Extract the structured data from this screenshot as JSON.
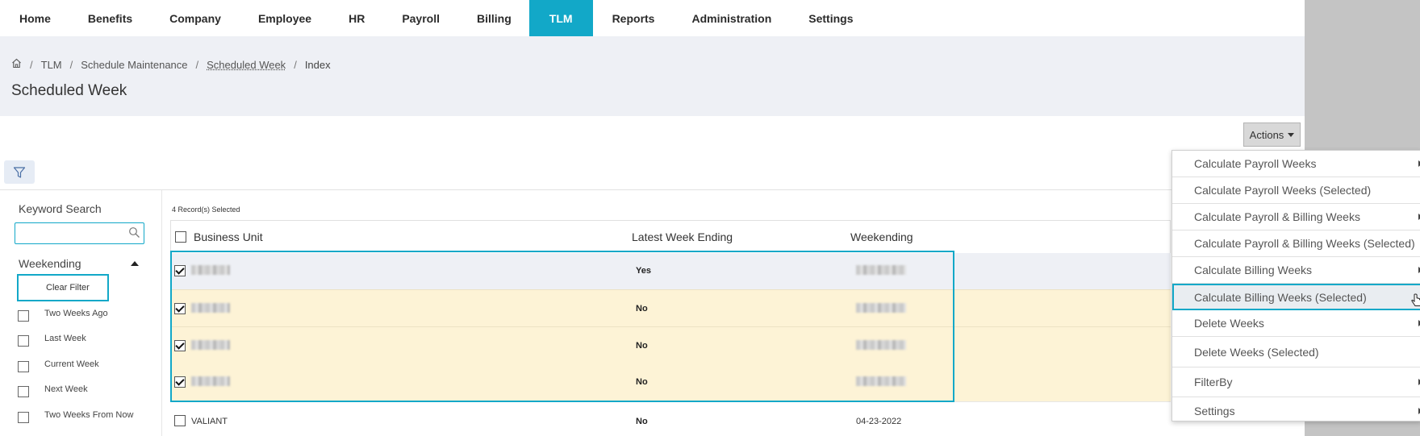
{
  "nav": {
    "items": [
      "Home",
      "Benefits",
      "Company",
      "Employee",
      "HR",
      "Payroll",
      "Billing",
      "TLM",
      "Reports",
      "Administration",
      "Settings"
    ],
    "active": "TLM"
  },
  "breadcrumb": {
    "items": [
      "TLM",
      "Schedule Maintenance",
      "Scheduled Week",
      "Index"
    ]
  },
  "page_title": "Scheduled Week",
  "actions_label": "Actions",
  "sidebar": {
    "keyword_label": "Keyword Search",
    "keyword_value": "",
    "weekending_label": "Weekending",
    "clear_filter": "Clear Filter",
    "options": [
      "Two Weeks Ago",
      "Last Week",
      "Current Week",
      "Next Week",
      "Two Weeks From Now"
    ]
  },
  "table": {
    "records_selected": "4 Record(s) Selected",
    "headers": {
      "business_unit": "Business Unit",
      "latest": "Latest Week Ending",
      "weekending": "Weekending"
    },
    "rows": [
      {
        "business_unit": "",
        "latest": "Yes",
        "weekending": "",
        "checked": true
      },
      {
        "business_unit": "",
        "latest": "No",
        "weekending": "",
        "checked": true
      },
      {
        "business_unit": "",
        "latest": "No",
        "weekending": "",
        "checked": true
      },
      {
        "business_unit": "",
        "latest": "No",
        "weekending": "",
        "checked": true
      },
      {
        "business_unit": "VALIANT",
        "latest": "No",
        "weekending": "04-23-2022",
        "checked": false
      }
    ]
  },
  "actions_menu": {
    "items": [
      {
        "label": "Calculate Payroll Weeks",
        "submenu": true
      },
      {
        "label": "Calculate Payroll Weeks (Selected)",
        "submenu": false
      },
      {
        "label": "Calculate Payroll & Billing Weeks",
        "submenu": true
      },
      {
        "label": "Calculate Payroll & Billing Weeks (Selected)",
        "submenu": false
      },
      {
        "label": "Calculate Billing Weeks",
        "submenu": true
      },
      {
        "label": "Calculate Billing Weeks (Selected)",
        "submenu": false,
        "highlighted": true
      },
      {
        "label": "Delete Weeks",
        "submenu": true
      },
      {
        "label": "Delete Weeks (Selected)",
        "submenu": false
      },
      {
        "label": "FilterBy",
        "submenu": true
      },
      {
        "label": "Settings",
        "submenu": true
      }
    ]
  },
  "colors": {
    "accent": "#12a8c8",
    "row_selected": "#fdf3d6",
    "row_first": "#eef0f5"
  }
}
